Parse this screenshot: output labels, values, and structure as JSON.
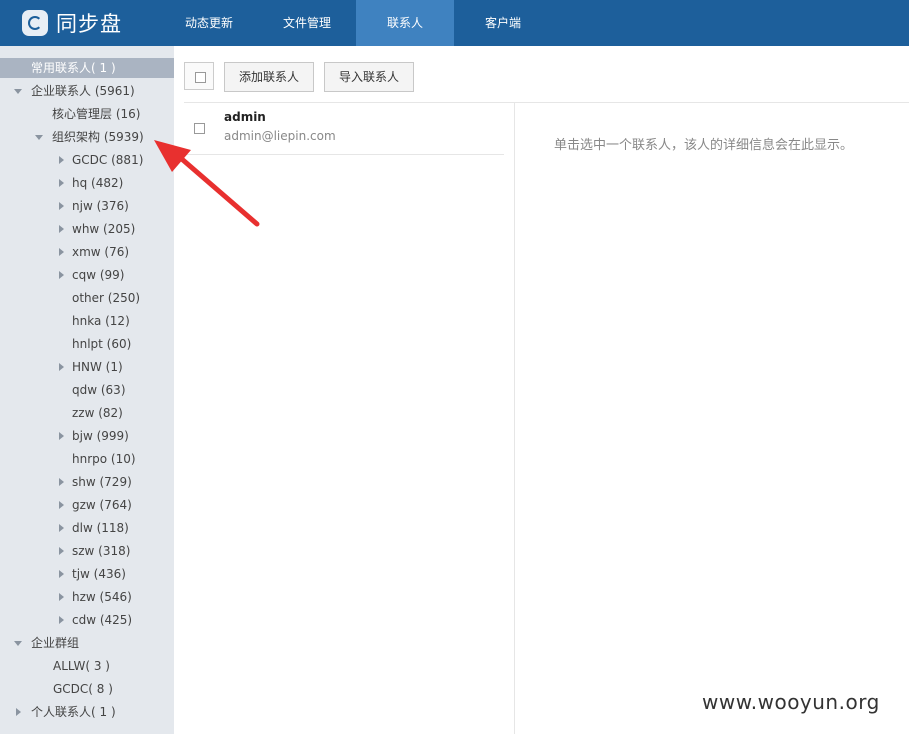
{
  "app": {
    "title": "同步盘"
  },
  "nav": {
    "tabs": [
      {
        "label": "动态更新"
      },
      {
        "label": "文件管理"
      },
      {
        "label": "联系人"
      },
      {
        "label": "客户端"
      }
    ]
  },
  "sidebar": {
    "frequent": "常用联系人( 1 )",
    "enterprise": "企业联系人 (5961)",
    "core": "核心管理层 (16)",
    "org": "组织架构 (5939)",
    "org_children": [
      "GCDC (881)",
      "hq (482)",
      "njw (376)",
      "whw (205)",
      "xmw (76)",
      "cqw (99)",
      "other (250)",
      "hnka (12)",
      "hnlpt (60)",
      "HNW (1)",
      "qdw (63)",
      "zzw (82)",
      "bjw (999)",
      "hnrpo (10)",
      "shw (729)",
      "gzw (764)",
      "dlw (118)",
      "szw (318)",
      "tjw (436)",
      "hzw (546)",
      "cdw (425)"
    ],
    "groups": "企业群组",
    "group_children": [
      "ALLW( 3 )",
      "GCDC( 8 )"
    ],
    "personal": "个人联系人( 1 )"
  },
  "toolbar": {
    "add_label": "添加联系人",
    "import_label": "导入联系人"
  },
  "contacts": [
    {
      "name": "admin",
      "email": "admin@liepin.com"
    }
  ],
  "detail": {
    "hint": "单击选中一个联系人，该人的详细信息会在此显示。"
  },
  "watermark": "www.wooyun.org",
  "colors": {
    "header_bg": "#1d5f9b",
    "active_tab": "#3f82c0",
    "sidebar_bg": "#e4e8ed",
    "annotation_arrow": "#e8302f"
  }
}
